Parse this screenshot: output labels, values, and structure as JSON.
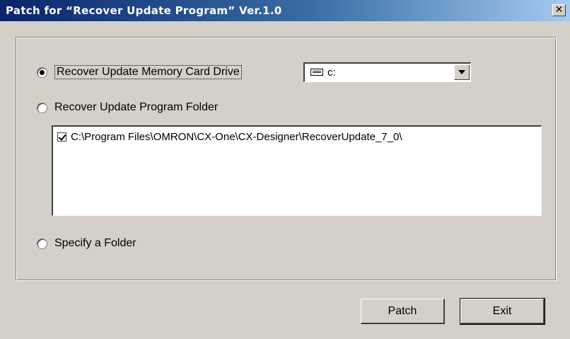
{
  "window": {
    "title": "Patch for “Recover Update Program” Ver.1.0",
    "close_glyph": "✕"
  },
  "options": {
    "drive_label": "Recover Update Memory Card Drive",
    "folder_label": "Recover Update Program Folder",
    "specify_label": "Specify a Folder",
    "selected": "drive"
  },
  "drive_combo": {
    "value": "c:",
    "icon": "drive-icon"
  },
  "folder_list": {
    "items": [
      {
        "checked": true,
        "path": "C:\\Program Files\\OMRON\\CX-One\\CX-Designer\\RecoverUpdate_7_0\\"
      }
    ]
  },
  "buttons": {
    "patch": "Patch",
    "exit": "Exit"
  }
}
